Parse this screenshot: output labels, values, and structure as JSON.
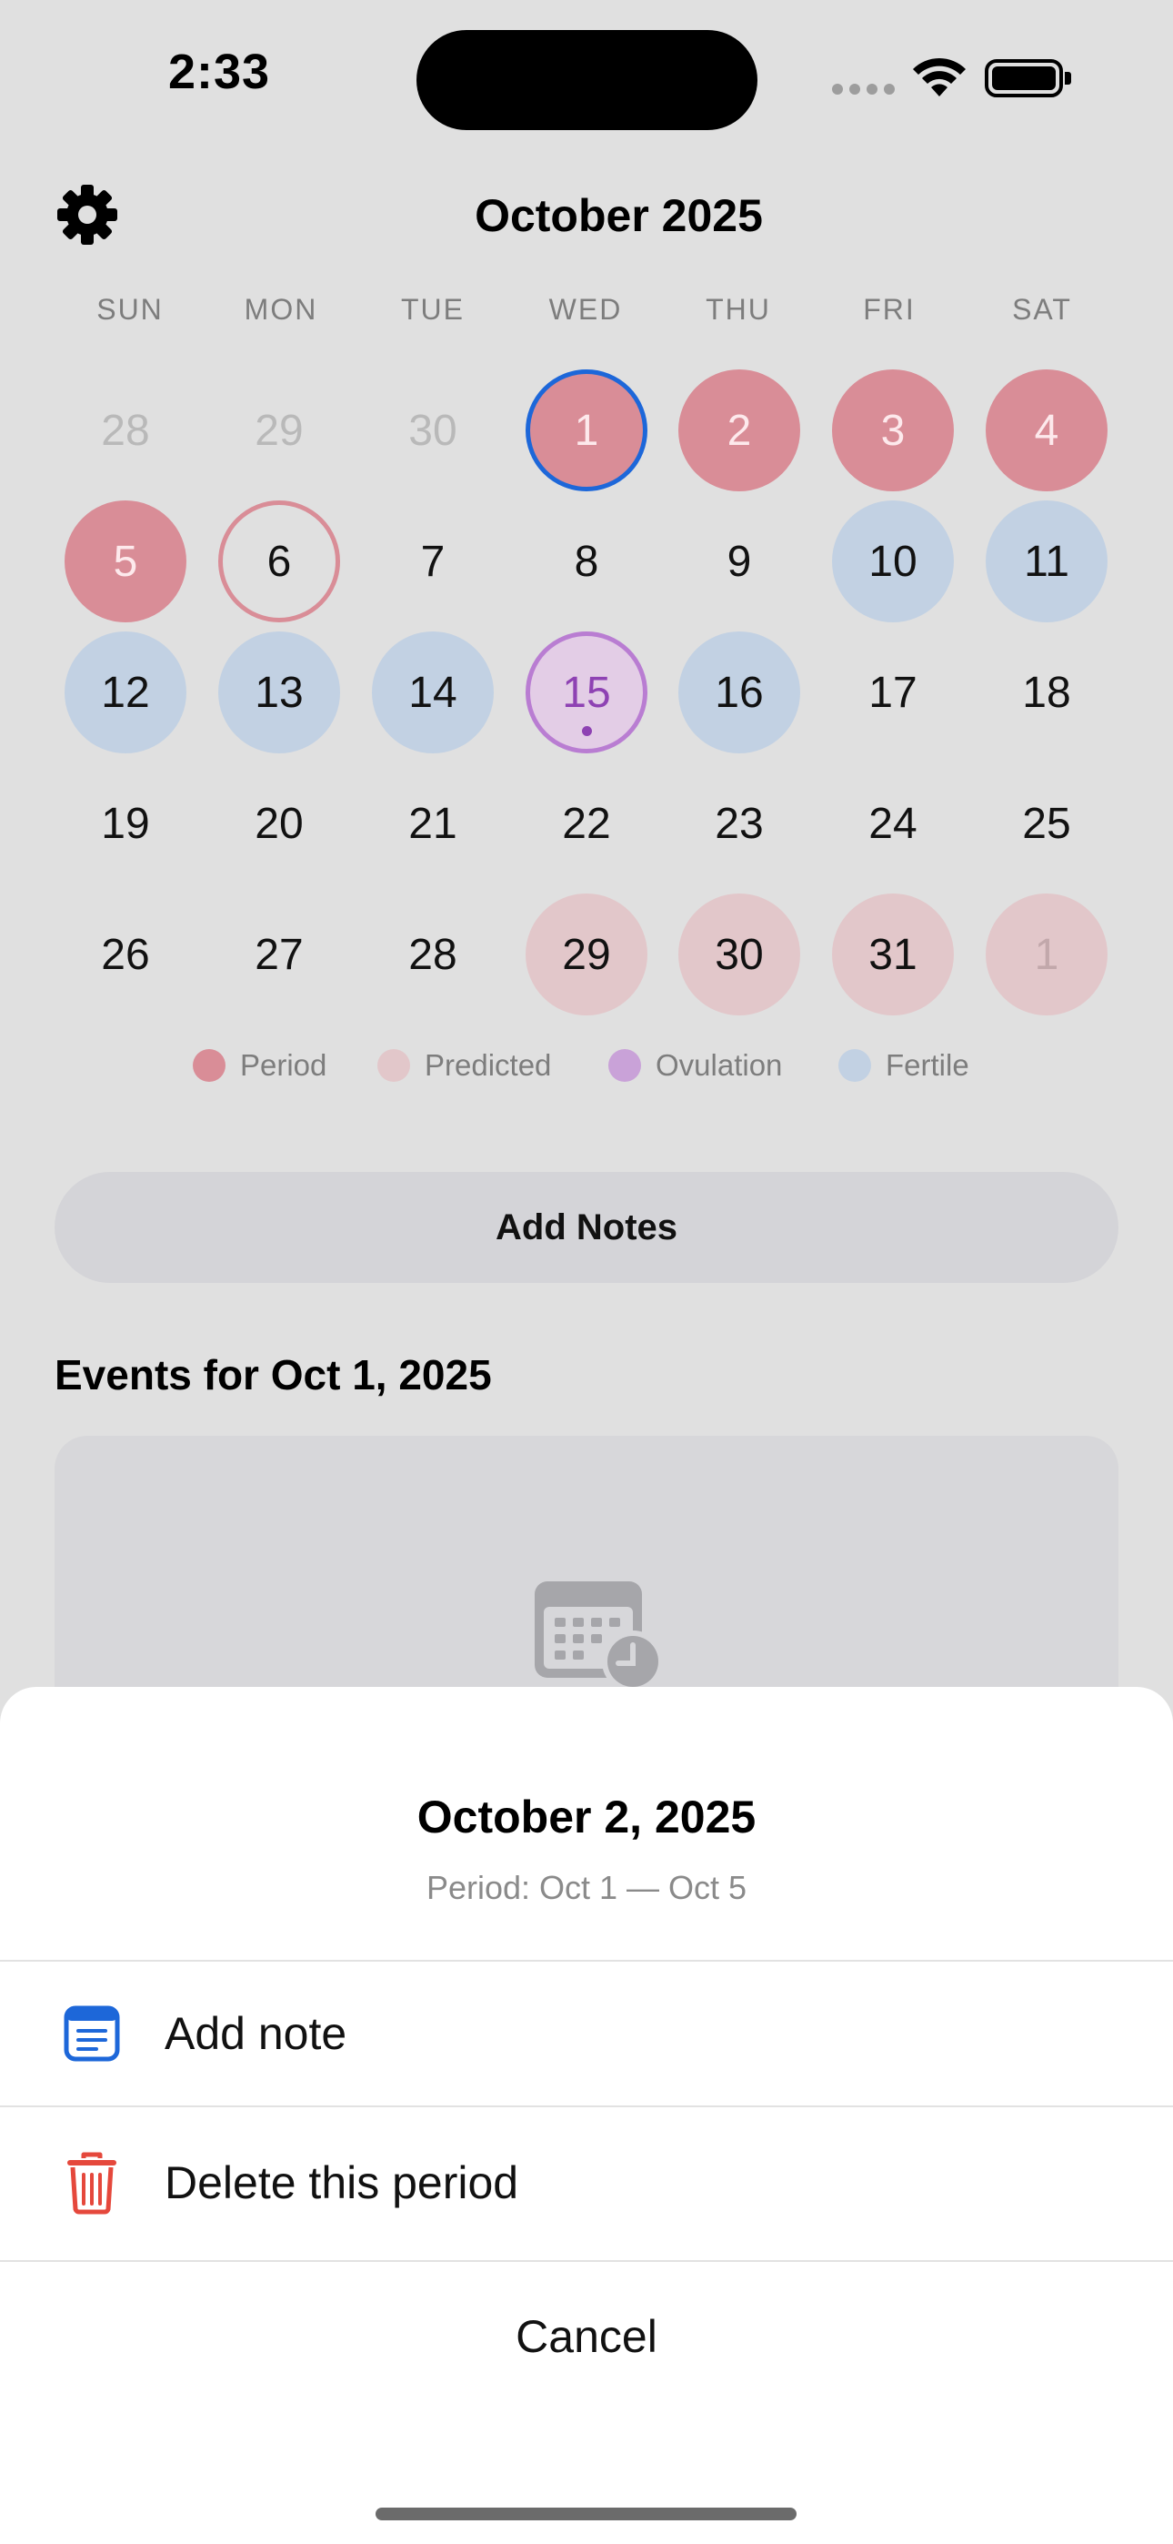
{
  "status_bar": {
    "time": "2:33"
  },
  "header": {
    "month_title": "October 2025"
  },
  "weekdays": [
    "SUN",
    "MON",
    "TUE",
    "WED",
    "THU",
    "FRI",
    "SAT"
  ],
  "calendar": {
    "weeks": [
      [
        {
          "day": "28",
          "state": "muted"
        },
        {
          "day": "29",
          "state": "muted"
        },
        {
          "day": "30",
          "state": "muted"
        },
        {
          "day": "1",
          "state": "selected"
        },
        {
          "day": "2",
          "state": "period"
        },
        {
          "day": "3",
          "state": "period"
        },
        {
          "day": "4",
          "state": "period"
        }
      ],
      [
        {
          "day": "5",
          "state": "period"
        },
        {
          "day": "6",
          "state": "outline"
        },
        {
          "day": "7",
          "state": "normal"
        },
        {
          "day": "8",
          "state": "normal"
        },
        {
          "day": "9",
          "state": "normal"
        },
        {
          "day": "10",
          "state": "fertile"
        },
        {
          "day": "11",
          "state": "fertile"
        }
      ],
      [
        {
          "day": "12",
          "state": "fertile"
        },
        {
          "day": "13",
          "state": "fertile"
        },
        {
          "day": "14",
          "state": "fertile"
        },
        {
          "day": "15",
          "state": "ovulation"
        },
        {
          "day": "16",
          "state": "fertile"
        },
        {
          "day": "17",
          "state": "normal"
        },
        {
          "day": "18",
          "state": "normal"
        }
      ],
      [
        {
          "day": "19",
          "state": "normal"
        },
        {
          "day": "20",
          "state": "normal"
        },
        {
          "day": "21",
          "state": "normal"
        },
        {
          "day": "22",
          "state": "normal"
        },
        {
          "day": "23",
          "state": "normal"
        },
        {
          "day": "24",
          "state": "normal"
        },
        {
          "day": "25",
          "state": "normal"
        }
      ],
      [
        {
          "day": "26",
          "state": "normal"
        },
        {
          "day": "27",
          "state": "normal"
        },
        {
          "day": "28",
          "state": "normal"
        },
        {
          "day": "29",
          "state": "predicted"
        },
        {
          "day": "30",
          "state": "predicted"
        },
        {
          "day": "31",
          "state": "predicted"
        },
        {
          "day": "1",
          "state": "predicted-muted"
        }
      ]
    ]
  },
  "legend": [
    {
      "label": "Period",
      "color": "#d98d97"
    },
    {
      "label": "Predicted",
      "color": "#e2c7ca"
    },
    {
      "label": "Ovulation",
      "color": "#c9a2d8"
    },
    {
      "label": "Fertile",
      "color": "#c2d1e3"
    }
  ],
  "main": {
    "add_notes_label": "Add Notes",
    "events_title": "Events for Oct 1, 2025"
  },
  "sheet": {
    "title": "October 2, 2025",
    "subtitle": "Period: Oct 1 — Oct 5",
    "actions": [
      {
        "label": "Add note",
        "icon": "note-icon"
      },
      {
        "label": "Delete this period",
        "icon": "trash-icon"
      }
    ],
    "cancel_label": "Cancel"
  },
  "colors": {
    "accent_blue": "#1d67d9",
    "destructive_red": "#e5483c",
    "period": "#d98d97",
    "fertile": "#c2d1e3",
    "ovulation": "#8e42b3"
  }
}
